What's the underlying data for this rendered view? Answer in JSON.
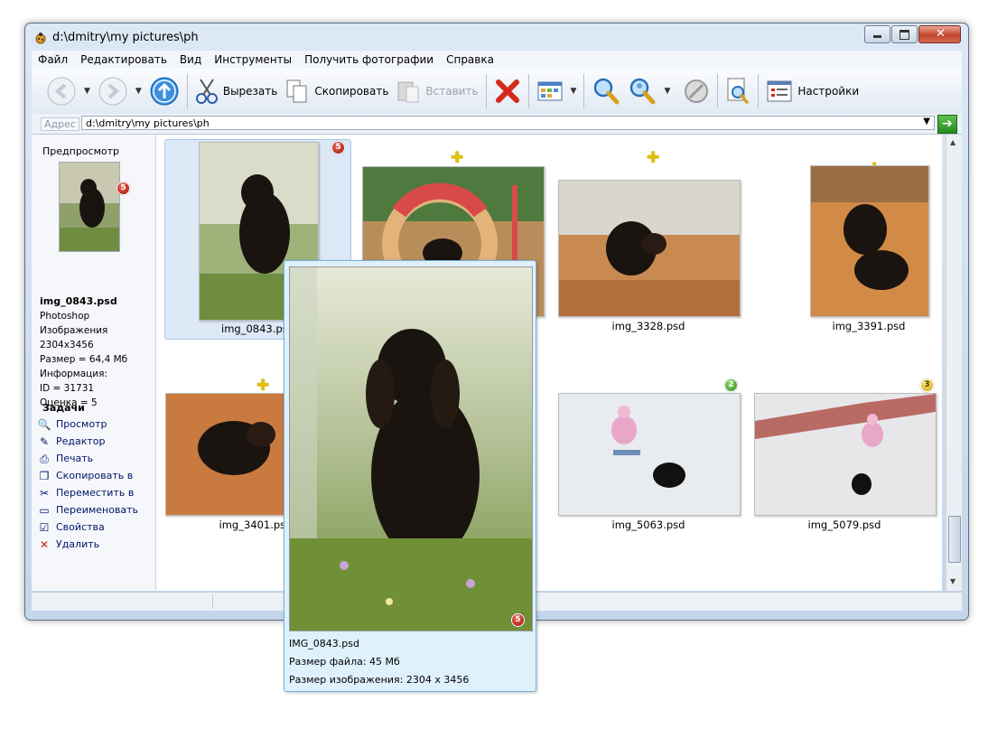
{
  "window": {
    "title": "d:\\dmitry\\my pictures\\ph"
  },
  "menu": [
    "Файл",
    "Редактировать",
    "Вид",
    "Инструменты",
    "Получить фотографии",
    "Справка"
  ],
  "toolbar": {
    "cut": "Вырезать",
    "copy": "Скопировать",
    "paste": "Вставить",
    "settings": "Настройки"
  },
  "address": {
    "label": "Адрес",
    "value": "d:\\dmitry\\my pictures\\ph"
  },
  "preview": {
    "title": "Предпросмотр",
    "rating_badge": "5",
    "filename": "img_0843.psd",
    "type": "Photoshop Изображения",
    "dimensions": "2304x3456",
    "size": "Размер = 64,4 Мб",
    "info": "Информация:",
    "id": "ID = 31731",
    "rating": "Оценка = 5"
  },
  "tasks": {
    "title": "Задачи",
    "items": [
      "Просмотр",
      "Редактор",
      "Печать",
      "Скопировать в",
      "Переместить в",
      "Переименовать",
      "Свойства",
      "Удалить"
    ]
  },
  "thumbnails": [
    {
      "name": "img_0843.psd",
      "badge": "5"
    },
    {
      "name": "",
      "badge": ""
    },
    {
      "name": "img_3328.psd",
      "badge": ""
    },
    {
      "name": "img_3391.psd",
      "badge": ""
    },
    {
      "name": "img_3401.psd",
      "badge": ""
    },
    {
      "name": "img_5063.psd",
      "badge": "2"
    },
    {
      "name": "img_5079.psd",
      "badge": "3"
    }
  ],
  "tooltip": {
    "name": "IMG_0843.psd",
    "file_size": "Размер файла: 45 Мб",
    "image_size": "Размер изображения: 2304 x 3456",
    "badge": "5"
  }
}
